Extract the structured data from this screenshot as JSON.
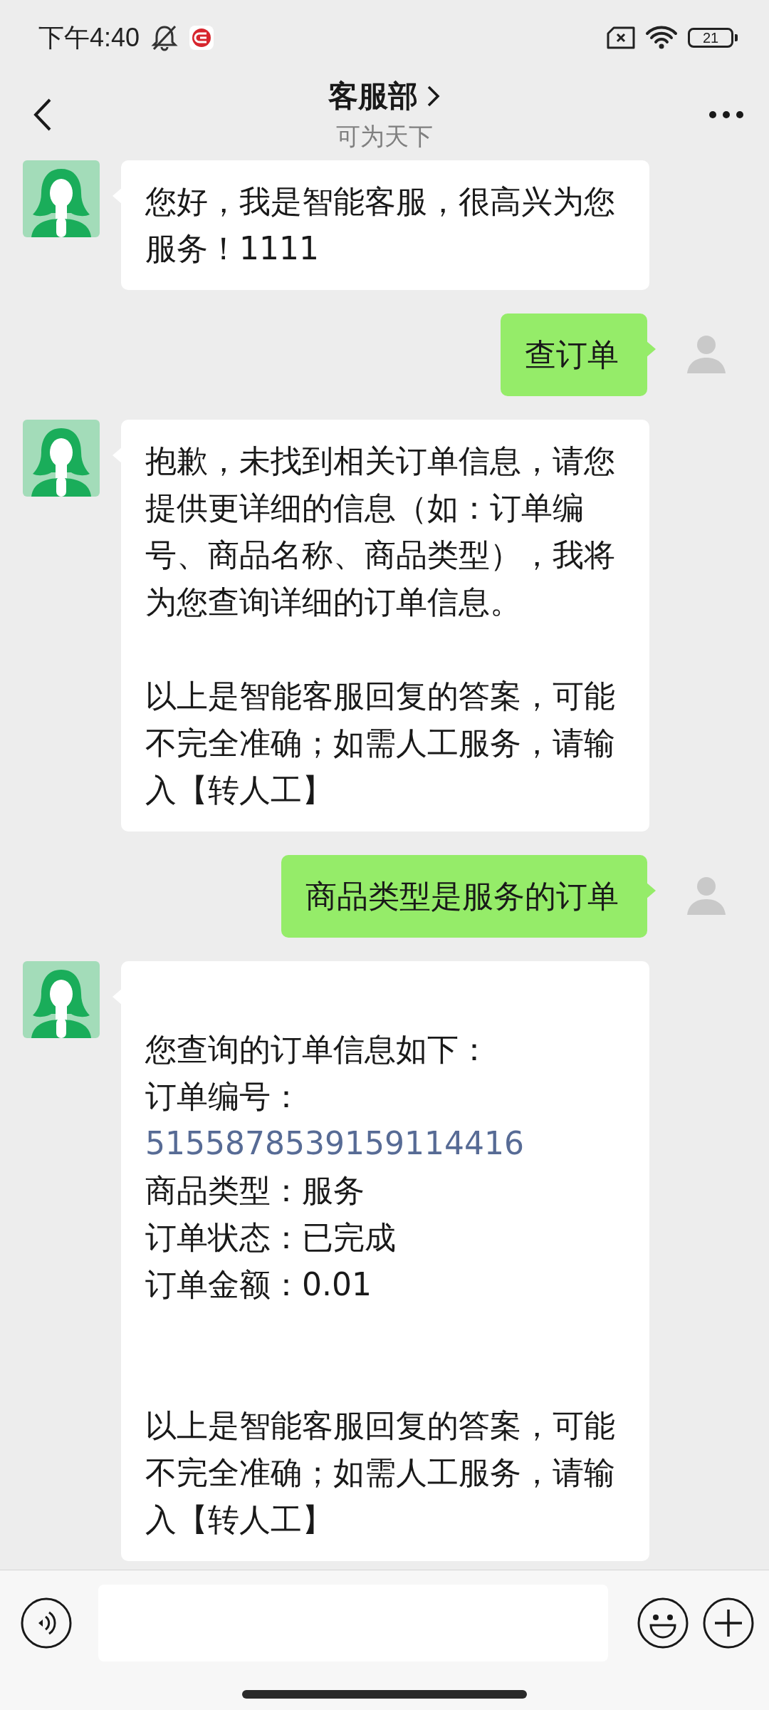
{
  "status_bar": {
    "time": "下午4:40",
    "battery": "21"
  },
  "header": {
    "title": "客服部",
    "subtitle": "可为天下"
  },
  "messages": [
    {
      "kind": "agent",
      "lines": [
        {
          "kind": "text",
          "text": "您好，我是智能客服，很高兴为您服务！1111"
        }
      ]
    },
    {
      "kind": "user",
      "lines": [
        {
          "kind": "text",
          "text": "查订单"
        }
      ]
    },
    {
      "kind": "agent",
      "lines": [
        {
          "kind": "text",
          "text": "抱歉，未找到相关订单信息，请您提供更详细的信息（如：订单编号、商品名称、商品类型），我将为您查询详细的订单信息。"
        },
        {
          "kind": "blank"
        },
        {
          "kind": "text",
          "text": "以上是智能客服回复的答案，可能不完全准确；如需人工服务，请输入【转人工】"
        }
      ]
    },
    {
      "kind": "user",
      "lines": [
        {
          "kind": "text",
          "text": "商品类型是服务的订单"
        }
      ]
    },
    {
      "kind": "agent",
      "lines": [
        {
          "kind": "blank"
        },
        {
          "kind": "text",
          "text": "您查询的订单信息如下："
        },
        {
          "kind": "text",
          "text": "订单编号："
        },
        {
          "kind": "link",
          "text": "5155878539159114416"
        },
        {
          "kind": "text",
          "text": "商品类型：服务"
        },
        {
          "kind": "text",
          "text": "订单状态：已完成"
        },
        {
          "kind": "text",
          "text": "订单金额：0.01"
        },
        {
          "kind": "blank"
        },
        {
          "kind": "blank"
        },
        {
          "kind": "text",
          "text": "以上是智能客服回复的答案，可能不完全准确；如需人工服务，请输入【转人工】"
        }
      ]
    }
  ]
}
